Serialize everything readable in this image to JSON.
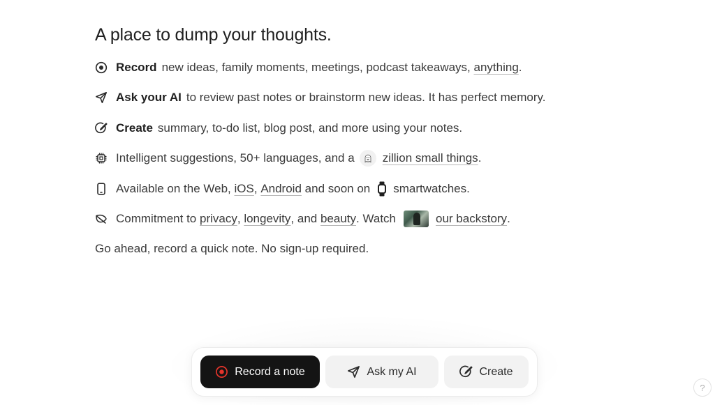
{
  "headline": "A place to dump your thoughts.",
  "features": {
    "record": {
      "icon": "record-circle-icon",
      "bold": "Record",
      "text": "new ideas, family moments, meetings, podcast takeaways,",
      "link": "anything",
      "end": "."
    },
    "ask": {
      "icon": "paper-plane-icon",
      "bold": "Ask your AI",
      "text": "to review past notes or brainstorm new ideas. It has perfect memory."
    },
    "create": {
      "icon": "edit-circle-icon",
      "bold": "Create",
      "text": "summary, to-do list, blog post, and more using your notes."
    },
    "suggestions": {
      "icon": "chip-icon",
      "text": "Intelligent suggestions, 50+ languages, and a",
      "emoji_icon": "ghost-emoji-icon",
      "link": "zillion small things",
      "end": "."
    },
    "platforms": {
      "icon": "phone-icon",
      "text_before": "Available on the Web,",
      "link_ios": "iOS",
      "comma": ",",
      "link_android": "Android",
      "text_mid": "and soon on",
      "watch_icon": "watch-icon",
      "text_end": "smartwatches."
    },
    "commitment": {
      "icon": "leaf-icon",
      "text_before": "Commitment to",
      "link_privacy": "privacy",
      "comma1": ",",
      "link_longevity": "longevity",
      "text_and": ", and",
      "link_beauty": "beauty",
      "text_watch": ". Watch",
      "thumbnail": "backstory-thumbnail",
      "link_backstory": "our backstory",
      "end": "."
    }
  },
  "cta": "Go ahead, record a quick note. No sign-up required.",
  "dock": {
    "record_label": "Record a note",
    "ask_label": "Ask my AI",
    "create_label": "Create"
  },
  "help_label": "?",
  "colors": {
    "accent_red": "#e5342b",
    "dark_button": "#141414",
    "light_button": "#f2f2f2"
  }
}
